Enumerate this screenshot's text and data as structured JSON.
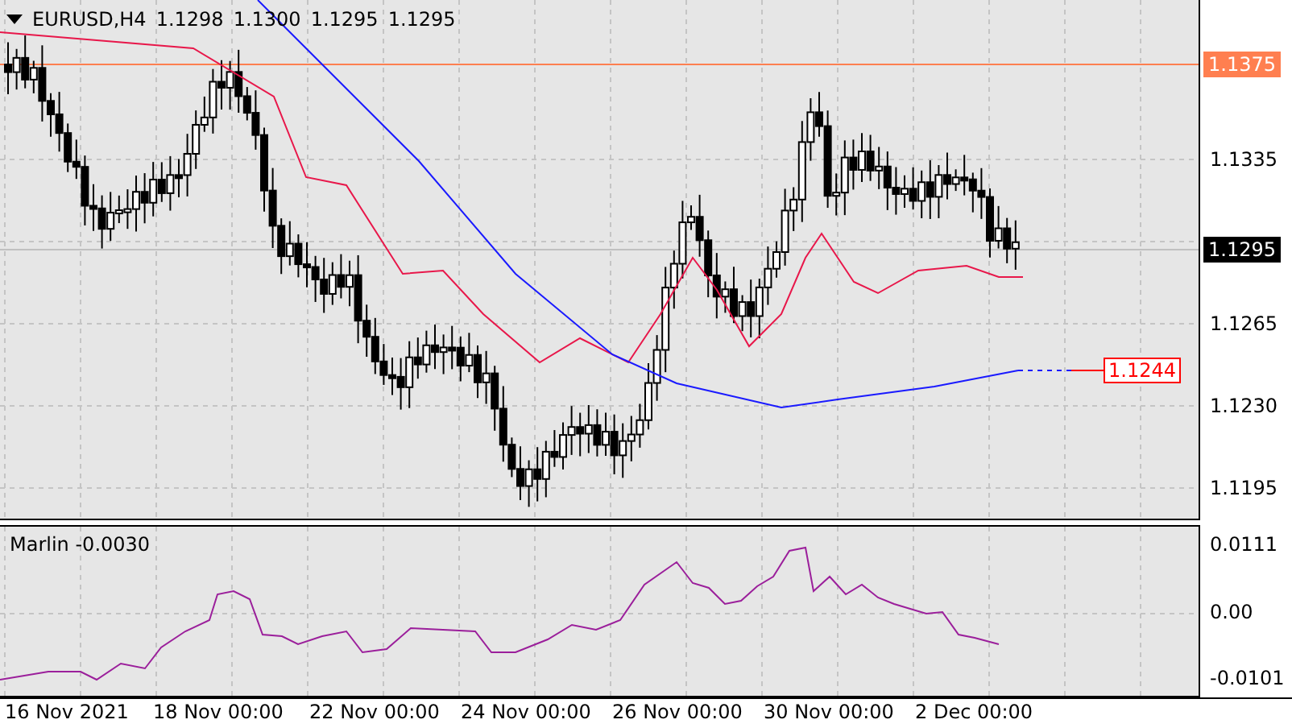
{
  "header": {
    "symbol": "EURUSD,H4",
    "quotes": [
      "1.1298",
      "1.1300",
      "1.1295",
      "1.1295"
    ]
  },
  "price_axis": {
    "ticks": [
      "1.1335",
      "1.1265",
      "1.1230",
      "1.1195"
    ]
  },
  "levels": [
    {
      "kind": "line",
      "label": "1.1375",
      "color": "#ff7f50"
    },
    {
      "kind": "current",
      "label": "1.1295",
      "color": "#000000"
    },
    {
      "kind": "boxed",
      "label": "1.1244",
      "color": "#ff0000"
    }
  ],
  "indicator": {
    "label": "Marlin -0.0030",
    "ticks": [
      "0.0111",
      "0.00",
      "-0.0101"
    ]
  },
  "time_axis": {
    "labels": [
      "16 Nov 2021",
      "18 Nov 00:00",
      "22 Nov 00:00",
      "24 Nov 00:00",
      "26 Nov 00:00",
      "30 Nov 00:00",
      "2 Dec 00:00"
    ]
  }
}
